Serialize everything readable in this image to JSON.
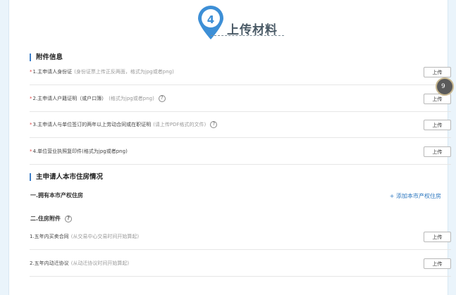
{
  "step": {
    "number": "4",
    "title": "上传材料"
  },
  "attachments": {
    "title": "附件信息",
    "upload_label": "上传",
    "items": [
      {
        "required": "*",
        "label": "1.主申请人身份证",
        "hint": "(身份证票上传正反两面，格式为jpg或者png)",
        "has_help": false
      },
      {
        "required": "*",
        "label": "2.主申请人户籍证明（或户口簿）",
        "hint": "(格式为jpg或者png)",
        "has_help": true
      },
      {
        "required": "*",
        "label": "3.主申请人与单位签订的两年以上劳动合同或在职证明",
        "hint": "(请上传PDF格式的文件)",
        "has_help": true
      },
      {
        "required": "*",
        "label": "4.单位营业执照复印件(格式为jpg或者png)",
        "hint": "",
        "has_help": false
      }
    ]
  },
  "housing": {
    "title": "主申请人本市住房情况",
    "owned": {
      "title": "一.拥有本市产权住房",
      "add_link": "+ 添加本市产权住房"
    },
    "attachments_title": "二.住房附件",
    "help_icon": "?",
    "items": [
      {
        "label": "1.五年内买卖合同",
        "hint": "(从交易中心交易时间开始算起)"
      },
      {
        "label": "2.五年内动迁协议",
        "hint": "(从动迁协议时间开始算起)"
      }
    ]
  },
  "floating_badge": "9"
}
